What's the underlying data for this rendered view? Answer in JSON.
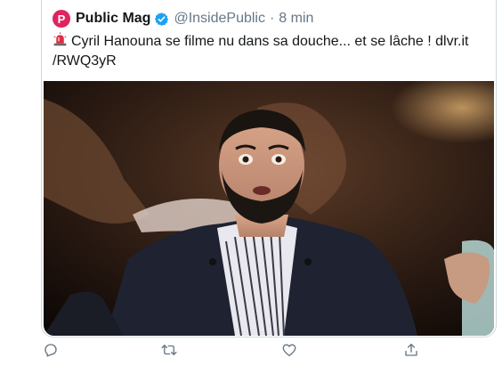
{
  "tweet": {
    "avatar_letter": "P",
    "name": "Public Mag",
    "handle": "@InsidePublic",
    "separator": "·",
    "time": "8 min",
    "text_line1": "Cyril Hanouna se filme nu dans sa douche... et se lâche ! dlvr.it",
    "text_line2": "/RWQ3yR"
  },
  "colors": {
    "avatar_bg": "#e0245e",
    "verified": "#1da1f2",
    "action_icon": "#657786",
    "border": "#cfd9de"
  },
  "icons": {
    "verified": "verified-badge-icon",
    "siren": "police-light-emoji",
    "reply": "reply-icon",
    "retweet": "retweet-icon",
    "like": "like-icon",
    "share": "share-icon"
  }
}
